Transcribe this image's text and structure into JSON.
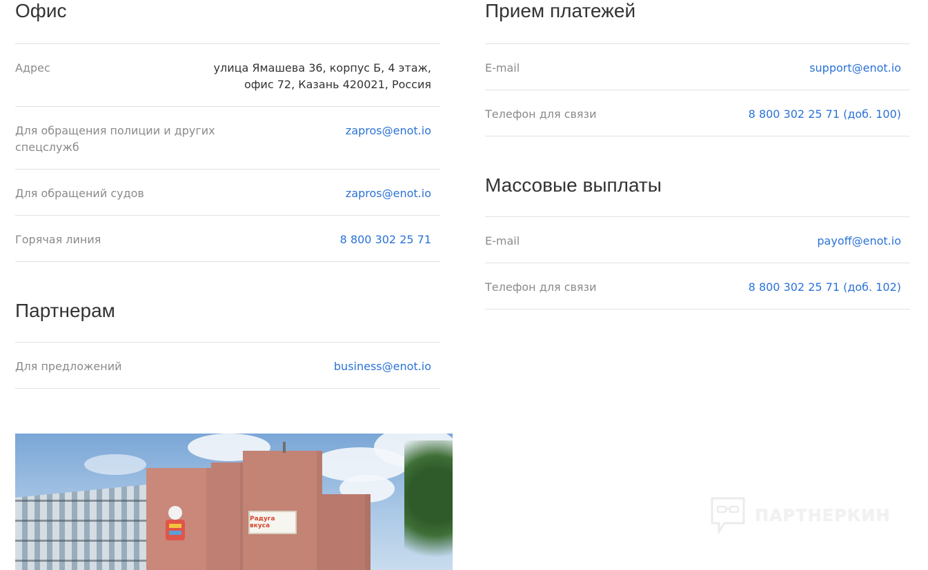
{
  "office": {
    "title": "Офис",
    "address_label": "Адрес",
    "address_line1": "улица Ямашева 36, корпус Б, 4 этаж,",
    "address_line2": "офис 72, Казань 420021, Россия",
    "police_label": "Для обращения полиции и других спецслужб",
    "police_email": "zapros@enot.io",
    "courts_label": "Для обращений судов",
    "courts_email": "zapros@enot.io",
    "hotline_label": "Горячая линия",
    "hotline_phone": "8 800 302 25 71"
  },
  "partners": {
    "title": "Партнерам",
    "offers_label": "Для предложений",
    "offers_email": "business@enot.io"
  },
  "payments": {
    "title": "Прием платежей",
    "email_label": "E-mail",
    "email": "support@enot.io",
    "phone_label": "Телефон для связи",
    "phone": "8 800 302 25 71 (доб. 100)"
  },
  "payouts": {
    "title": "Массовые выплаты",
    "email_label": "E-mail",
    "email": "payoff@enot.io",
    "phone_label": "Телефон для связи",
    "phone": "8 800 302 25 71 (доб. 102)"
  },
  "photo": {
    "sign_text": "Радуга вкуса"
  },
  "watermark": {
    "text": "ПАРТНЕРКИН"
  }
}
